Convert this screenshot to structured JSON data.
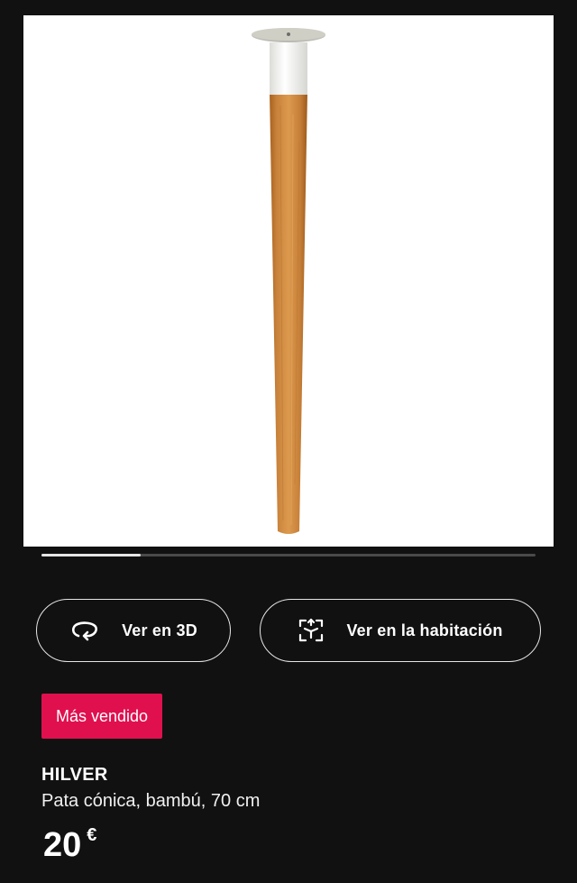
{
  "carousel": {
    "active_fraction": 0.2
  },
  "actions": {
    "view_3d_label": "Ver en 3D",
    "view_3d_icon": "rotate-3d-icon",
    "view_room_label": "Ver en la habitación",
    "view_room_icon": "augmented-reality-icon"
  },
  "badge": {
    "label": "Más vendido",
    "color": "#e0104f"
  },
  "product": {
    "name": "HILVER",
    "description": "Pata cónica, bambú, 70 cm",
    "price_value": "20",
    "price_currency": "€"
  },
  "colors": {
    "background": "#111111",
    "image_background": "#ffffff",
    "wood": "#c8813a",
    "cap": "#f4f4f2"
  }
}
